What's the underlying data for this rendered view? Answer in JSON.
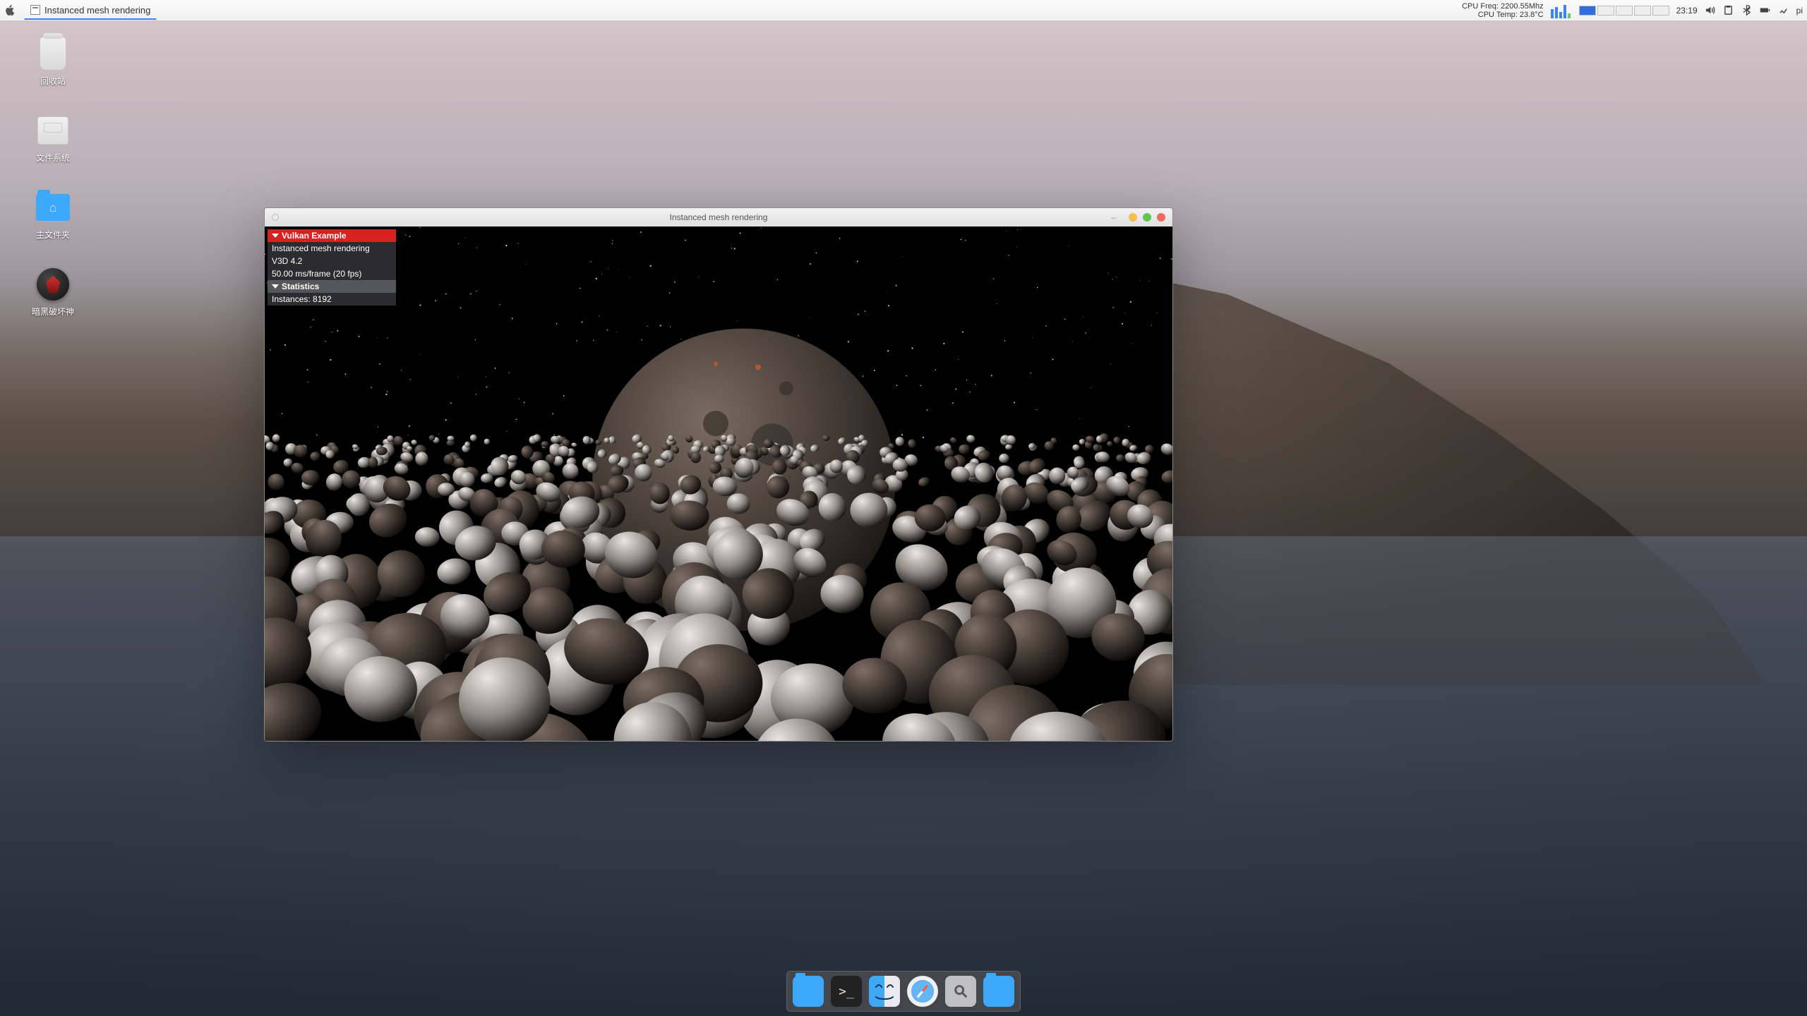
{
  "menubar": {
    "app_task_label": "Instanced mesh rendering",
    "cpu_freq_label": "CPU Freq: 2200.55Mhz",
    "cpu_temp_label": "CPU Temp: 23.8°C",
    "clock": "23:19",
    "host_label": "pi"
  },
  "desktop": {
    "trash_label": "回收站",
    "filesystem_label": "文件系统",
    "home_label": "主文件夹",
    "game_label": "暗黑破坏神"
  },
  "window": {
    "title": "Instanced mesh rendering",
    "minimize_glyph": "–"
  },
  "imgui": {
    "header": "Vulkan Example",
    "line1": "Instanced mesh rendering",
    "line2": "V3D 4.2",
    "line3": "50.00 ms/frame (20 fps)",
    "stats_header": "Statistics",
    "instances": "Instances: 8192"
  },
  "dock": {
    "items": [
      "files",
      "terminal",
      "finder",
      "safari",
      "search",
      "folder"
    ]
  }
}
